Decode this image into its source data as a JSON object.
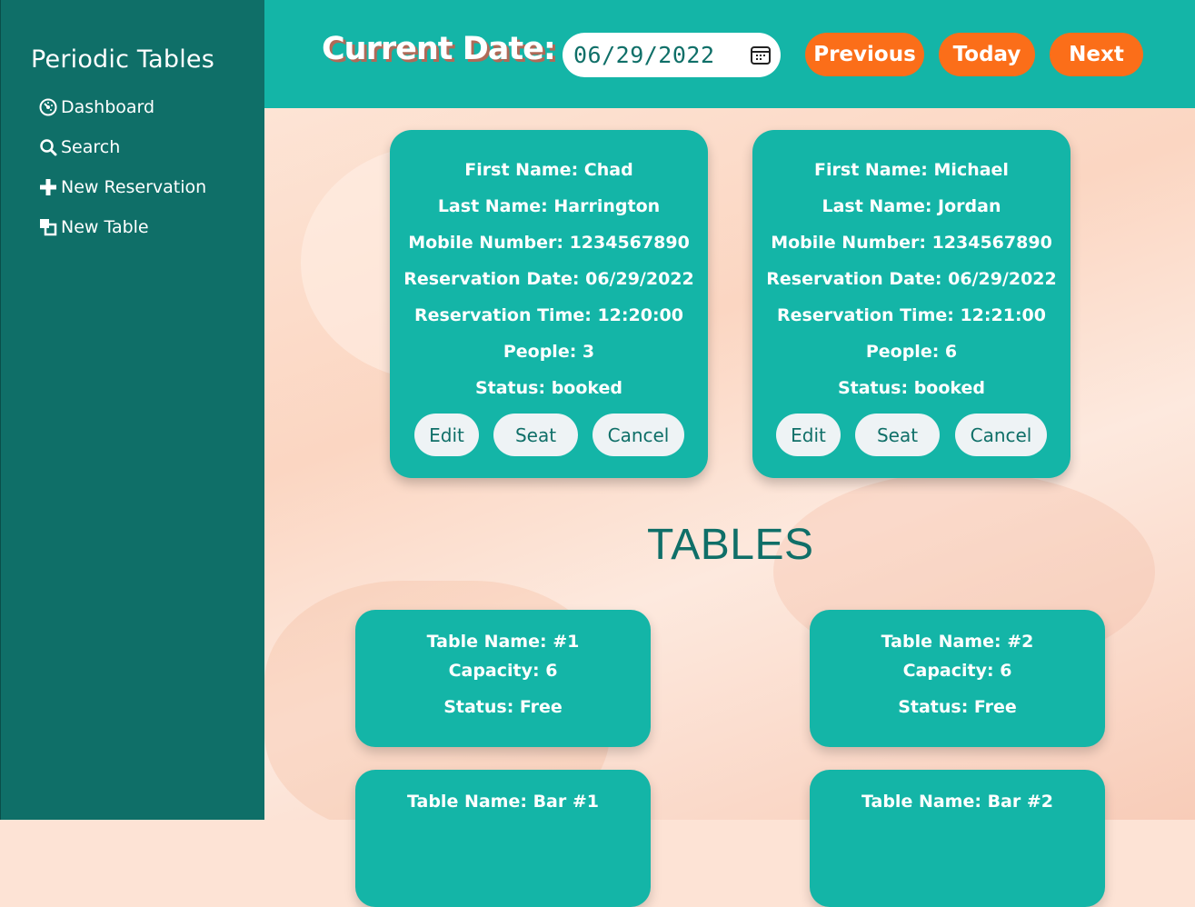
{
  "sidebar": {
    "brand": "Periodic Tables",
    "items": [
      {
        "label": "Dashboard"
      },
      {
        "label": "Search"
      },
      {
        "label": "New Reservation"
      },
      {
        "label": "New Table"
      }
    ]
  },
  "header": {
    "current_date_label": "Current Date:",
    "date_value": "06/29/2022",
    "previous": "Previous",
    "today": "Today",
    "next": "Next"
  },
  "colors": {
    "sidebar": "#0f6f68",
    "teal": "#14b5a7",
    "accent": "#fb6e19"
  },
  "reservations": [
    {
      "first": "First Name: Chad",
      "last": "Last Name: Harrington",
      "mobile": "Mobile Number: 1234567890",
      "date": "Reservation Date: 06/29/2022",
      "time": "Reservation Time: 12:20:00",
      "people": "People: 3",
      "status": "Status: booked",
      "edit": "Edit",
      "seat": "Seat",
      "cancel": "Cancel"
    },
    {
      "first": "First Name: Michael",
      "last": "Last Name: Jordan",
      "mobile": "Mobile Number: 1234567890",
      "date": "Reservation Date: 06/29/2022",
      "time": "Reservation Time: 12:21:00",
      "people": "People: 6",
      "status": "Status: booked",
      "edit": "Edit",
      "seat": "Seat",
      "cancel": "Cancel"
    }
  ],
  "tables_heading": "TABLES",
  "tables": [
    {
      "name": "Table Name: #1",
      "capacity": "Capacity: 6",
      "status": "Status: Free"
    },
    {
      "name": "Table Name: #2",
      "capacity": "Capacity: 6",
      "status": "Status: Free"
    },
    {
      "name": "Table Name: Bar #1"
    },
    {
      "name": "Table Name: Bar #2"
    }
  ]
}
